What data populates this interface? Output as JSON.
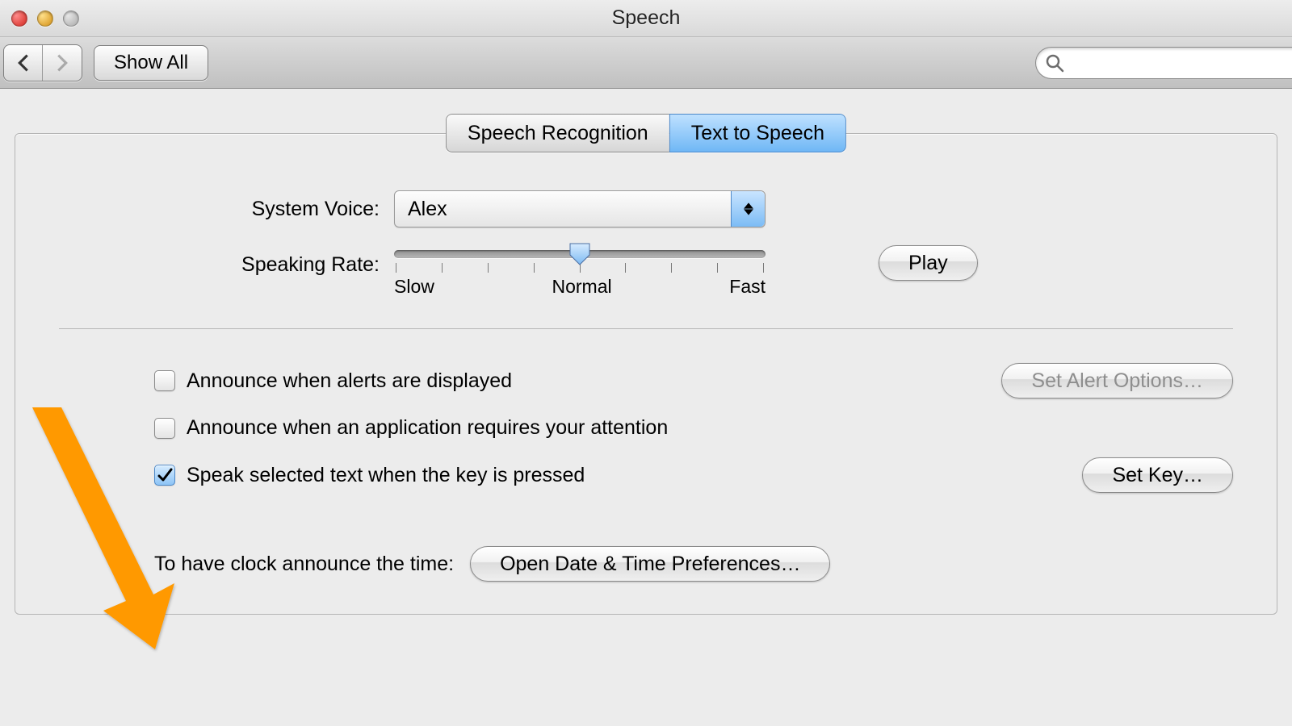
{
  "window": {
    "title": "Speech"
  },
  "toolbar": {
    "back_enabled": true,
    "forward_enabled": false,
    "show_all_label": "Show All",
    "search_placeholder": ""
  },
  "tabs": [
    {
      "label": "Speech Recognition",
      "selected": false
    },
    {
      "label": "Text to Speech",
      "selected": true
    }
  ],
  "voice": {
    "label": "System Voice:",
    "value": "Alex"
  },
  "rate": {
    "label": "Speaking Rate:",
    "ticks": {
      "slow": "Slow",
      "normal": "Normal",
      "fast": "Fast"
    },
    "value_percent": 50,
    "play_label": "Play"
  },
  "options": {
    "announce_alerts": {
      "label": "Announce when alerts are displayed",
      "checked": false
    },
    "announce_app": {
      "label": "Announce when an application requires your attention",
      "checked": false
    },
    "speak_selected": {
      "label": "Speak selected text when the key is pressed",
      "checked": true
    },
    "set_alert_label": "Set Alert Options…",
    "set_key_label": "Set Key…"
  },
  "clock": {
    "intro": "To have clock announce the time:",
    "button": "Open Date & Time Preferences…"
  },
  "colors": {
    "annotation": "#ff9900"
  }
}
